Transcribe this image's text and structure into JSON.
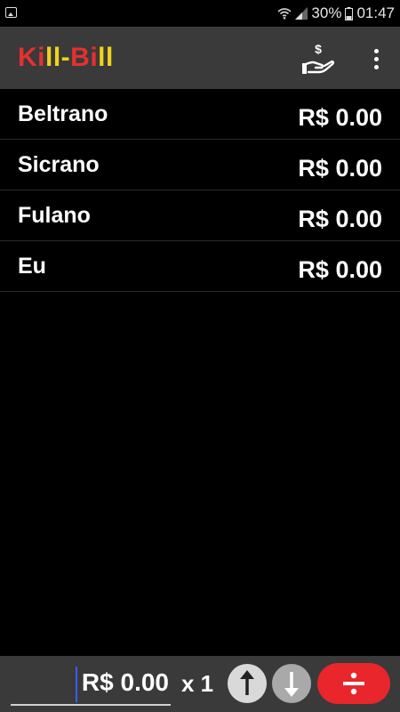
{
  "status_bar": {
    "battery": "30%",
    "time": "01:47",
    "icons": [
      "gallery-icon",
      "wifi-icon",
      "signal-icon",
      "battery-icon"
    ]
  },
  "app_bar": {
    "title_part1": "Ki",
    "title_part2": "ll-",
    "title_part3": "Bi",
    "title_part4": "ll",
    "actions": [
      "pay-hand-icon",
      "more-vert-icon"
    ],
    "colors": {
      "red": "#e53030",
      "yellow": "#f2d21b",
      "bar": "#3a3a3a"
    }
  },
  "people": [
    {
      "name": "Beltrano",
      "amount": "R$ 0.00"
    },
    {
      "name": "Sicrano",
      "amount": "R$ 0.00"
    },
    {
      "name": "Fulano",
      "amount": "R$ 0.00"
    },
    {
      "name": "Eu",
      "amount": "R$ 0.00"
    }
  ],
  "bottom_bar": {
    "amount_value": "R$ 0.00",
    "multiplier": "x 1",
    "buttons": [
      "arrow-up-icon",
      "arrow-down-icon",
      "divide-icon"
    ],
    "accent": "#e8262b"
  }
}
